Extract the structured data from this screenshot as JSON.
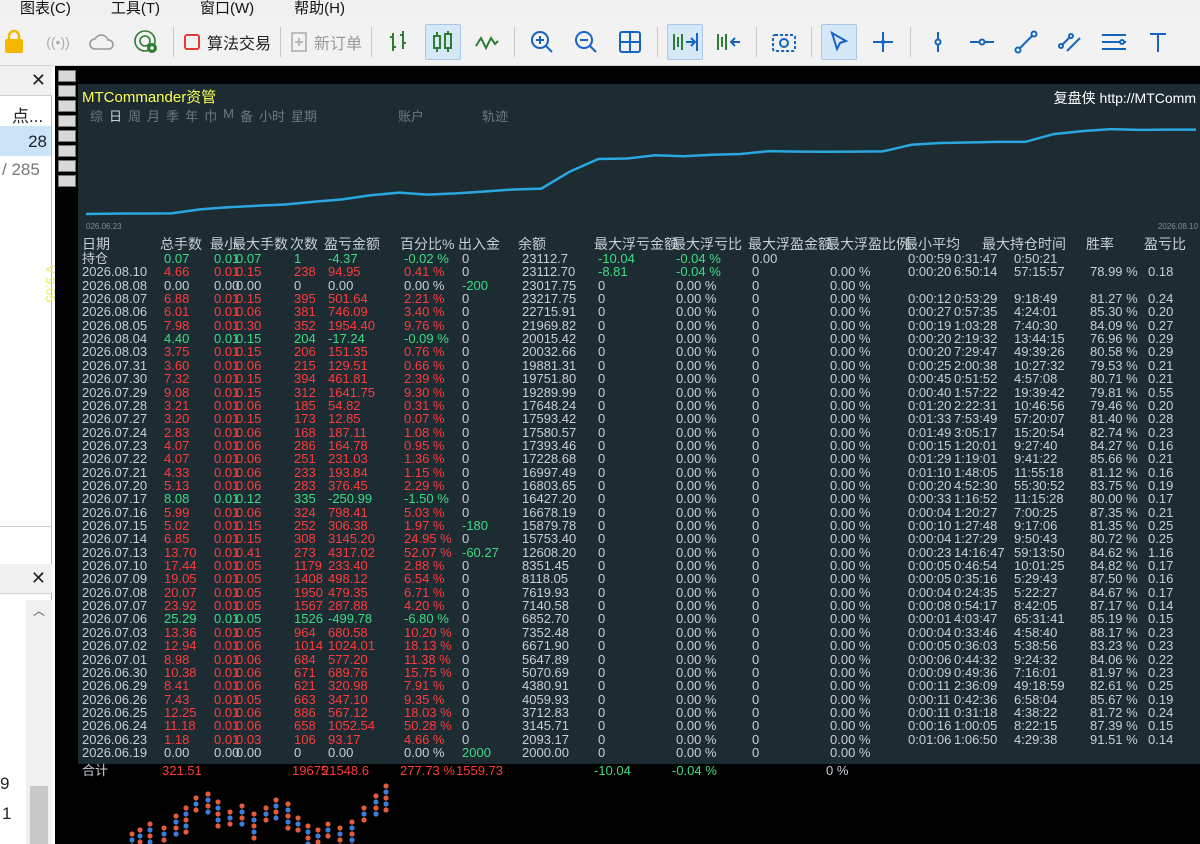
{
  "menu": [
    "图表(C)",
    "工具(T)",
    "窗口(W)",
    "帮助(H)"
  ],
  "toolbar": {
    "algo_trading": "算法交易",
    "new_order": "新订单"
  },
  "left_panel": {
    "item1": "点...",
    "item2": "28",
    "item3": "/ 285",
    "bottom1": "9",
    "bottom2": "1"
  },
  "version_label": "V 9.05",
  "mtc": {
    "title": "MTCommander资管",
    "link": "复盘侠 http://MTComm",
    "period_tabs": [
      "综",
      "日",
      "周",
      "月",
      "季",
      "年",
      "巾",
      "M",
      "备",
      "小时",
      "星期"
    ],
    "tab_account": "账户",
    "tab_track": "轨迹",
    "equity_start_date": "026.06.23",
    "equity_end_date": "2026.08.10",
    "equity_curve": [
      2000,
      2093,
      2135,
      2145,
      3145,
      3712,
      4059,
      4380,
      5070,
      5647,
      6671,
      7352,
      6852,
      7140,
      7619,
      8118,
      8351,
      12608,
      15753,
      15879,
      16678,
      16427,
      16803,
      16997,
      17728,
      17593,
      17580,
      17593,
      17648,
      19289,
      19751,
      19881,
      20032,
      20015,
      21969,
      22715,
      23217,
      23017,
      23112,
      23112
    ],
    "headers": [
      "日期",
      "总手数",
      "最小",
      "最大手数",
      "次数",
      "盈亏金额",
      "百分比%",
      "出入金",
      "余额",
      "最大浮亏金额",
      "最大浮亏比",
      "最大浮盈金额",
      "最大浮盈比例",
      "最小平均",
      "最大持仓时间",
      "胜率",
      "盈亏比"
    ],
    "rows": [
      {
        "date": "持仓",
        "lots": "0.07",
        "min": "0.01",
        "max": "0.07",
        "cnt": "1",
        "pl": "-4.37",
        "pct": "-0.02 %",
        "io": "0",
        "bal": "23112.7",
        "mfl": "-10.04",
        "mflp": "-0.04 %",
        "mfp": "0.00",
        "mfpp": "",
        "tmin": "0:00:59",
        "tavg": "0:31:47",
        "tmax": "0:50:21",
        "win": "",
        "ratio": "",
        "s": "pos"
      },
      {
        "date": "2026.08.10",
        "lots": "4.66",
        "min": "0.01",
        "max": "0.15",
        "cnt": "238",
        "pl": "94.95",
        "pct": "0.41 %",
        "io": "0",
        "bal": "23112.70",
        "mfl": "-8.81",
        "mflp": "-0.04 %",
        "mfp": "0",
        "mfpp": "0.00 %",
        "tmin": "0:00:20",
        "tavg": "6:50:14",
        "tmax": "57:15:57",
        "win": "78.99 %",
        "ratio": "0.18",
        "s": "neg"
      },
      {
        "date": "2026.08.08",
        "lots": "0.00",
        "min": "0.00",
        "max": "0.00",
        "cnt": "0",
        "pl": "0.00",
        "pct": "0.00 %",
        "io": "-200",
        "bal": "23017.75",
        "mfl": "0",
        "mflp": "0.00 %",
        "mfp": "0",
        "mfpp": "0.00 %",
        "tmin": "",
        "tavg": "",
        "tmax": "",
        "win": "",
        "ratio": "",
        "s": "neu"
      },
      {
        "date": "2026.08.07",
        "lots": "6.88",
        "min": "0.01",
        "max": "0.15",
        "cnt": "395",
        "pl": "501.64",
        "pct": "2.21 %",
        "io": "0",
        "bal": "23217.75",
        "mfl": "0",
        "mflp": "0.00 %",
        "mfp": "0",
        "mfpp": "0.00 %",
        "tmin": "0:00:12",
        "tavg": "0:53:29",
        "tmax": "9:18:49",
        "win": "81.27 %",
        "ratio": "0.24",
        "s": "neg"
      },
      {
        "date": "2026.08.06",
        "lots": "6.01",
        "min": "0.01",
        "max": "0.06",
        "cnt": "381",
        "pl": "746.09",
        "pct": "3.40 %",
        "io": "0",
        "bal": "22715.91",
        "mfl": "0",
        "mflp": "0.00 %",
        "mfp": "0",
        "mfpp": "0.00 %",
        "tmin": "0:00:27",
        "tavg": "0:57:35",
        "tmax": "4:24:01",
        "win": "85.30 %",
        "ratio": "0.20",
        "s": "neg"
      },
      {
        "date": "2026.08.05",
        "lots": "7.98",
        "min": "0.01",
        "max": "0.30",
        "cnt": "352",
        "pl": "1954.40",
        "pct": "9.76 %",
        "io": "0",
        "bal": "21969.82",
        "mfl": "0",
        "mflp": "0.00 %",
        "mfp": "0",
        "mfpp": "0.00 %",
        "tmin": "0:00:19",
        "tavg": "1:03:28",
        "tmax": "7:40:30",
        "win": "84.09 %",
        "ratio": "0.27",
        "s": "neg"
      },
      {
        "date": "2026.08.04",
        "lots": "4.40",
        "min": "0.01",
        "max": "0.15",
        "cnt": "204",
        "pl": "-17.24",
        "pct": "-0.09 %",
        "io": "0",
        "bal": "20015.42",
        "mfl": "0",
        "mflp": "0.00 %",
        "mfp": "0",
        "mfpp": "0.00 %",
        "tmin": "0:00:20",
        "tavg": "2:19:32",
        "tmax": "13:44:15",
        "win": "76.96 %",
        "ratio": "0.29",
        "s": "pos"
      },
      {
        "date": "2026.08.03",
        "lots": "3.75",
        "min": "0.01",
        "max": "0.15",
        "cnt": "206",
        "pl": "151.35",
        "pct": "0.76 %",
        "io": "0",
        "bal": "20032.66",
        "mfl": "0",
        "mflp": "0.00 %",
        "mfp": "0",
        "mfpp": "0.00 %",
        "tmin": "0:00:20",
        "tavg": "7:29:47",
        "tmax": "49:39:26",
        "win": "80.58 %",
        "ratio": "0.29",
        "s": "neg"
      },
      {
        "date": "2026.07.31",
        "lots": "3.60",
        "min": "0.01",
        "max": "0.06",
        "cnt": "215",
        "pl": "129.51",
        "pct": "0.66 %",
        "io": "0",
        "bal": "19881.31",
        "mfl": "0",
        "mflp": "0.00 %",
        "mfp": "0",
        "mfpp": "0.00 %",
        "tmin": "0:00:25",
        "tavg": "2:00:38",
        "tmax": "10:27:32",
        "win": "79.53 %",
        "ratio": "0.21",
        "s": "neg"
      },
      {
        "date": "2026.07.30",
        "lots": "7.32",
        "min": "0.01",
        "max": "0.15",
        "cnt": "394",
        "pl": "461.81",
        "pct": "2.39 %",
        "io": "0",
        "bal": "19751.80",
        "mfl": "0",
        "mflp": "0.00 %",
        "mfp": "0",
        "mfpp": "0.00 %",
        "tmin": "0:00:45",
        "tavg": "0:51:52",
        "tmax": "4:57:08",
        "win": "80.71 %",
        "ratio": "0.21",
        "s": "neg"
      },
      {
        "date": "2026.07.29",
        "lots": "9.08",
        "min": "0.01",
        "max": "0.15",
        "cnt": "312",
        "pl": "1641.75",
        "pct": "9.30 %",
        "io": "0",
        "bal": "19289.99",
        "mfl": "0",
        "mflp": "0.00 %",
        "mfp": "0",
        "mfpp": "0.00 %",
        "tmin": "0:00:40",
        "tavg": "1:57:22",
        "tmax": "19:39:42",
        "win": "79.81 %",
        "ratio": "0.55",
        "s": "neg"
      },
      {
        "date": "2026.07.28",
        "lots": "3.21",
        "min": "0.01",
        "max": "0.06",
        "cnt": "185",
        "pl": "54.82",
        "pct": "0.31 %",
        "io": "0",
        "bal": "17648.24",
        "mfl": "0",
        "mflp": "0.00 %",
        "mfp": "0",
        "mfpp": "0.00 %",
        "tmin": "0:01:20",
        "tavg": "2:22:31",
        "tmax": "10:46:56",
        "win": "79.46 %",
        "ratio": "0.20",
        "s": "neg"
      },
      {
        "date": "2026.07.27",
        "lots": "3.20",
        "min": "0.01",
        "max": "0.15",
        "cnt": "173",
        "pl": "12.85",
        "pct": "0.07 %",
        "io": "0",
        "bal": "17593.42",
        "mfl": "0",
        "mflp": "0.00 %",
        "mfp": "0",
        "mfpp": "0.00 %",
        "tmin": "0:01:33",
        "tavg": "7:53:49",
        "tmax": "57:20:07",
        "win": "81.40 %",
        "ratio": "0.28",
        "s": "neg"
      },
      {
        "date": "2026.07.24",
        "lots": "2.83",
        "min": "0.01",
        "max": "0.06",
        "cnt": "168",
        "pl": "187.11",
        "pct": "1.08 %",
        "io": "0",
        "bal": "17580.57",
        "mfl": "0",
        "mflp": "0.00 %",
        "mfp": "0",
        "mfpp": "0.00 %",
        "tmin": "0:01:49",
        "tavg": "3:05:17",
        "tmax": "15:20:54",
        "win": "82.74 %",
        "ratio": "0.23",
        "s": "neg"
      },
      {
        "date": "2026.07.23",
        "lots": "4.07",
        "min": "0.01",
        "max": "0.06",
        "cnt": "286",
        "pl": "164.78",
        "pct": "0.95 %",
        "io": "0",
        "bal": "17393.46",
        "mfl": "0",
        "mflp": "0.00 %",
        "mfp": "0",
        "mfpp": "0.00 %",
        "tmin": "0:00:15",
        "tavg": "1:20:01",
        "tmax": "9:27:40",
        "win": "84.27 %",
        "ratio": "0.16",
        "s": "neg"
      },
      {
        "date": "2026.07.22",
        "lots": "4.07",
        "min": "0.01",
        "max": "0.06",
        "cnt": "251",
        "pl": "231.03",
        "pct": "1.36 %",
        "io": "0",
        "bal": "17228.68",
        "mfl": "0",
        "mflp": "0.00 %",
        "mfp": "0",
        "mfpp": "0.00 %",
        "tmin": "0:01:29",
        "tavg": "1:19:01",
        "tmax": "9:41:22",
        "win": "85.66 %",
        "ratio": "0.21",
        "s": "neg"
      },
      {
        "date": "2026.07.21",
        "lots": "4.33",
        "min": "0.01",
        "max": "0.06",
        "cnt": "233",
        "pl": "193.84",
        "pct": "1.15 %",
        "io": "0",
        "bal": "16997.49",
        "mfl": "0",
        "mflp": "0.00 %",
        "mfp": "0",
        "mfpp": "0.00 %",
        "tmin": "0:01:10",
        "tavg": "1:48:05",
        "tmax": "11:55:18",
        "win": "81.12 %",
        "ratio": "0.16",
        "s": "neg"
      },
      {
        "date": "2026.07.20",
        "lots": "5.13",
        "min": "0.01",
        "max": "0.06",
        "cnt": "283",
        "pl": "376.45",
        "pct": "2.29 %",
        "io": "0",
        "bal": "16803.65",
        "mfl": "0",
        "mflp": "0.00 %",
        "mfp": "0",
        "mfpp": "0.00 %",
        "tmin": "0:00:20",
        "tavg": "4:52:30",
        "tmax": "55:30:52",
        "win": "83.75 %",
        "ratio": "0.19",
        "s": "neg"
      },
      {
        "date": "2026.07.17",
        "lots": "8.08",
        "min": "0.01",
        "max": "0.12",
        "cnt": "335",
        "pl": "-250.99",
        "pct": "-1.50 %",
        "io": "0",
        "bal": "16427.20",
        "mfl": "0",
        "mflp": "0.00 %",
        "mfp": "0",
        "mfpp": "0.00 %",
        "tmin": "0:00:33",
        "tavg": "1:16:52",
        "tmax": "11:15:28",
        "win": "80.00 %",
        "ratio": "0.17",
        "s": "pos"
      },
      {
        "date": "2026.07.16",
        "lots": "5.99",
        "min": "0.01",
        "max": "0.06",
        "cnt": "324",
        "pl": "798.41",
        "pct": "5.03 %",
        "io": "0",
        "bal": "16678.19",
        "mfl": "0",
        "mflp": "0.00 %",
        "mfp": "0",
        "mfpp": "0.00 %",
        "tmin": "0:00:04",
        "tavg": "1:20:27",
        "tmax": "7:00:25",
        "win": "87.35 %",
        "ratio": "0.21",
        "s": "neg"
      },
      {
        "date": "2026.07.15",
        "lots": "5.02",
        "min": "0.01",
        "max": "0.15",
        "cnt": "252",
        "pl": "306.38",
        "pct": "1.97 %",
        "io": "-180",
        "bal": "15879.78",
        "mfl": "0",
        "mflp": "0.00 %",
        "mfp": "0",
        "mfpp": "0.00 %",
        "tmin": "0:00:10",
        "tavg": "1:27:48",
        "tmax": "9:17:06",
        "win": "81.35 %",
        "ratio": "0.25",
        "s": "neg"
      },
      {
        "date": "2026.07.14",
        "lots": "6.85",
        "min": "0.01",
        "max": "0.15",
        "cnt": "308",
        "pl": "3145.20",
        "pct": "24.95 %",
        "io": "0",
        "bal": "15753.40",
        "mfl": "0",
        "mflp": "0.00 %",
        "mfp": "0",
        "mfpp": "0.00 %",
        "tmin": "0:00:04",
        "tavg": "1:27:29",
        "tmax": "9:50:43",
        "win": "80.72 %",
        "ratio": "0.25",
        "s": "neg"
      },
      {
        "date": "2026.07.13",
        "lots": "13.70",
        "min": "0.01",
        "max": "0.41",
        "cnt": "273",
        "pl": "4317.02",
        "pct": "52.07 %",
        "io": "-60.27",
        "bal": "12608.20",
        "mfl": "0",
        "mflp": "0.00 %",
        "mfp": "0",
        "mfpp": "0.00 %",
        "tmin": "0:00:23",
        "tavg": "14:16:47",
        "tmax": "59:13:50",
        "win": "84.62 %",
        "ratio": "1.16",
        "s": "neg"
      },
      {
        "date": "2026.07.10",
        "lots": "17.44",
        "min": "0.01",
        "max": "0.05",
        "cnt": "1179",
        "pl": "233.40",
        "pct": "2.88 %",
        "io": "0",
        "bal": "8351.45",
        "mfl": "0",
        "mflp": "0.00 %",
        "mfp": "0",
        "mfpp": "0.00 %",
        "tmin": "0:00:05",
        "tavg": "0:46:54",
        "tmax": "10:01:25",
        "win": "84.82 %",
        "ratio": "0.17",
        "s": "neg"
      },
      {
        "date": "2026.07.09",
        "lots": "19.05",
        "min": "0.01",
        "max": "0.05",
        "cnt": "1408",
        "pl": "498.12",
        "pct": "6.54 %",
        "io": "0",
        "bal": "8118.05",
        "mfl": "0",
        "mflp": "0.00 %",
        "mfp": "0",
        "mfpp": "0.00 %",
        "tmin": "0:00:05",
        "tavg": "0:35:16",
        "tmax": "5:29:43",
        "win": "87.50 %",
        "ratio": "0.16",
        "s": "neg"
      },
      {
        "date": "2026.07.08",
        "lots": "20.07",
        "min": "0.01",
        "max": "0.05",
        "cnt": "1950",
        "pl": "479.35",
        "pct": "6.71 %",
        "io": "0",
        "bal": "7619.93",
        "mfl": "0",
        "mflp": "0.00 %",
        "mfp": "0",
        "mfpp": "0.00 %",
        "tmin": "0:00:04",
        "tavg": "0:24:35",
        "tmax": "5:22:27",
        "win": "84.67 %",
        "ratio": "0.17",
        "s": "neg"
      },
      {
        "date": "2026.07.07",
        "lots": "23.92",
        "min": "0.01",
        "max": "0.05",
        "cnt": "1567",
        "pl": "287.88",
        "pct": "4.20 %",
        "io": "0",
        "bal": "7140.58",
        "mfl": "0",
        "mflp": "0.00 %",
        "mfp": "0",
        "mfpp": "0.00 %",
        "tmin": "0:00:08",
        "tavg": "0:54:17",
        "tmax": "8:42:05",
        "win": "87.17 %",
        "ratio": "0.14",
        "s": "neg"
      },
      {
        "date": "2026.07.06",
        "lots": "25.29",
        "min": "0.01",
        "max": "0.05",
        "cnt": "1526",
        "pl": "-499.78",
        "pct": "-6.80 %",
        "io": "0",
        "bal": "6852.70",
        "mfl": "0",
        "mflp": "0.00 %",
        "mfp": "0",
        "mfpp": "0.00 %",
        "tmin": "0:00:01",
        "tavg": "4:03:47",
        "tmax": "65:31:41",
        "win": "85.19 %",
        "ratio": "0.15",
        "s": "pos"
      },
      {
        "date": "2026.07.03",
        "lots": "13.36",
        "min": "0.01",
        "max": "0.05",
        "cnt": "964",
        "pl": "680.58",
        "pct": "10.20 %",
        "io": "0",
        "bal": "7352.48",
        "mfl": "0",
        "mflp": "0.00 %",
        "mfp": "0",
        "mfpp": "0.00 %",
        "tmin": "0:00:04",
        "tavg": "0:33:46",
        "tmax": "4:58:40",
        "win": "88.17 %",
        "ratio": "0.23",
        "s": "neg"
      },
      {
        "date": "2026.07.02",
        "lots": "12.94",
        "min": "0.01",
        "max": "0.06",
        "cnt": "1014",
        "pl": "1024.01",
        "pct": "18.13 %",
        "io": "0",
        "bal": "6671.90",
        "mfl": "0",
        "mflp": "0.00 %",
        "mfp": "0",
        "mfpp": "0.00 %",
        "tmin": "0:00:05",
        "tavg": "0:36:03",
        "tmax": "5:38:56",
        "win": "83.23 %",
        "ratio": "0.23",
        "s": "neg"
      },
      {
        "date": "2026.07.01",
        "lots": "8.98",
        "min": "0.01",
        "max": "0.06",
        "cnt": "684",
        "pl": "577.20",
        "pct": "11.38 %",
        "io": "0",
        "bal": "5647.89",
        "mfl": "0",
        "mflp": "0.00 %",
        "mfp": "0",
        "mfpp": "0.00 %",
        "tmin": "0:00:06",
        "tavg": "0:44:32",
        "tmax": "9:24:32",
        "win": "84.06 %",
        "ratio": "0.22",
        "s": "neg"
      },
      {
        "date": "2026.06.30",
        "lots": "10.38",
        "min": "0.01",
        "max": "0.06",
        "cnt": "671",
        "pl": "689.76",
        "pct": "15.75 %",
        "io": "0",
        "bal": "5070.69",
        "mfl": "0",
        "mflp": "0.00 %",
        "mfp": "0",
        "mfpp": "0.00 %",
        "tmin": "0:00:09",
        "tavg": "0:49:36",
        "tmax": "7:16:01",
        "win": "81.97 %",
        "ratio": "0.23",
        "s": "neg"
      },
      {
        "date": "2026.06.29",
        "lots": "8.41",
        "min": "0.01",
        "max": "0.06",
        "cnt": "621",
        "pl": "320.98",
        "pct": "7.91 %",
        "io": "0",
        "bal": "4380.91",
        "mfl": "0",
        "mflp": "0.00 %",
        "mfp": "0",
        "mfpp": "0.00 %",
        "tmin": "0:00:11",
        "tavg": "2:36:09",
        "tmax": "49:18:59",
        "win": "82.61 %",
        "ratio": "0.25",
        "s": "neg"
      },
      {
        "date": "2026.06.26",
        "lots": "7.43",
        "min": "0.01",
        "max": "0.05",
        "cnt": "663",
        "pl": "347.10",
        "pct": "9.35 %",
        "io": "0",
        "bal": "4059.93",
        "mfl": "0",
        "mflp": "0.00 %",
        "mfp": "0",
        "mfpp": "0.00 %",
        "tmin": "0:00:11",
        "tavg": "0:42:36",
        "tmax": "6:58:04",
        "win": "85.67 %",
        "ratio": "0.19",
        "s": "neg"
      },
      {
        "date": "2026.06.25",
        "lots": "12.25",
        "min": "0.01",
        "max": "0.06",
        "cnt": "886",
        "pl": "567.12",
        "pct": "18.03 %",
        "io": "0",
        "bal": "3712.83",
        "mfl": "0",
        "mflp": "0.00 %",
        "mfp": "0",
        "mfpp": "0.00 %",
        "tmin": "0:00:11",
        "tavg": "0:31:18",
        "tmax": "4:38:22",
        "win": "81.72 %",
        "ratio": "0.24",
        "s": "neg"
      },
      {
        "date": "2026.06.24",
        "lots": "11.18",
        "min": "0.01",
        "max": "0.06",
        "cnt": "658",
        "pl": "1052.54",
        "pct": "50.28 %",
        "io": "0",
        "bal": "3145.71",
        "mfl": "0",
        "mflp": "0.00 %",
        "mfp": "0",
        "mfpp": "0.00 %",
        "tmin": "0:00:16",
        "tavg": "1:00:05",
        "tmax": "8:22:15",
        "win": "87.39 %",
        "ratio": "0.15",
        "s": "neg"
      },
      {
        "date": "2026.06.23",
        "lots": "1.18",
        "min": "0.01",
        "max": "0.03",
        "cnt": "106",
        "pl": "93.17",
        "pct": "4.66 %",
        "io": "0",
        "bal": "2093.17",
        "mfl": "0",
        "mflp": "0.00 %",
        "mfp": "0",
        "mfpp": "0.00 %",
        "tmin": "0:01:06",
        "tavg": "1:06:50",
        "tmax": "4:29:38",
        "win": "91.51 %",
        "ratio": "0.14",
        "s": "neg"
      },
      {
        "date": "2026.06.19",
        "lots": "0.00",
        "min": "0.00",
        "max": "0.00",
        "cnt": "0",
        "pl": "0.00",
        "pct": "0.00 %",
        "io": "2000",
        "bal": "2000.00",
        "mfl": "0",
        "mflp": "0.00 %",
        "mfp": "0",
        "mfpp": "0.00 %",
        "tmin": "",
        "tavg": "",
        "tmax": "",
        "win": "",
        "ratio": "",
        "s": "neu"
      }
    ],
    "totals": {
      "label": "合计",
      "lots": "321.51",
      "cnt": "19675",
      "pl": "21548.6",
      "pct": "277.73 %",
      "io": "1559.73",
      "mfl": "-10.04",
      "mflp": "-0.04 %",
      "mfpp": "0 %"
    }
  },
  "colors": {
    "panel_bg": "#1d2b33",
    "negative_red": "#ff3b3b",
    "positive_green": "#3ddc84",
    "title_yellow": "#ffff55",
    "equity_line": "#29a8e0"
  }
}
